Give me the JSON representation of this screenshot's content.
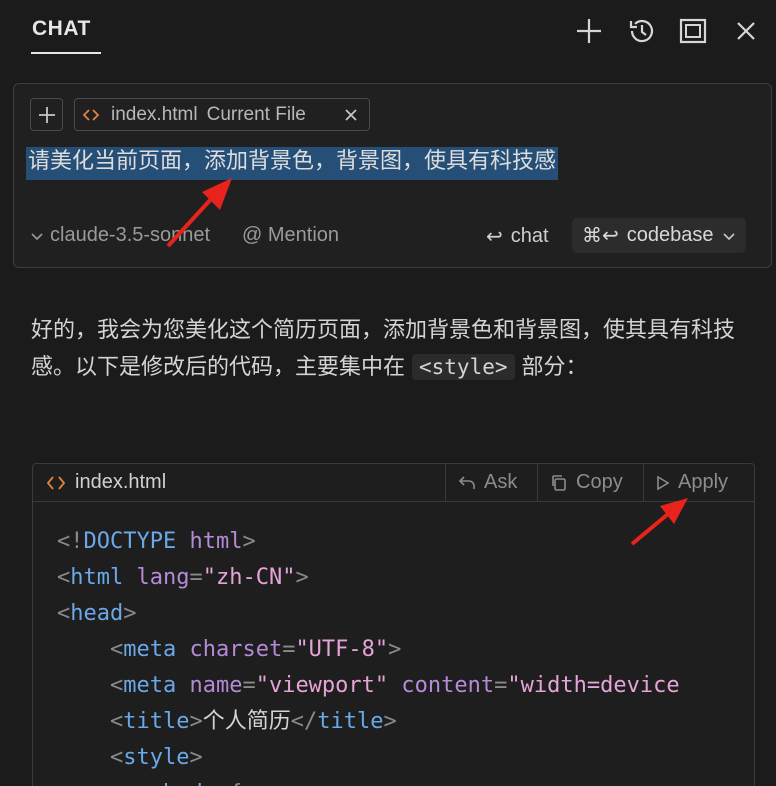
{
  "header": {
    "tab_label": "CHAT",
    "icons": [
      "plus-icon",
      "history-icon",
      "maximize-icon",
      "close-icon"
    ]
  },
  "input": {
    "add_context_icon": "plus-icon",
    "file_chip": {
      "name": "index.html",
      "tag": "Current File"
    },
    "prompt": "请美化当前页面，添加背景色，背景图，使具有科技感",
    "model": "claude-3.5-sonnet",
    "mention": "@ Mention",
    "chat_label": "chat",
    "codebase_label": "codebase",
    "codebase_shortcut": "⌘↩"
  },
  "response": {
    "text_before": "好的，我会为您美化这个简历页面，添加背景色和背景图，使其具有科技感。以下是修改后的代码，主要集中在 ",
    "inline_code": "<style>",
    "text_after": " 部分："
  },
  "code_block": {
    "filename": "index.html",
    "actions": {
      "ask": "Ask",
      "copy": "Copy",
      "apply": "Apply"
    }
  },
  "colors": {
    "background": "#1b1b1b",
    "selection": "#264f78",
    "tag": "#6aa8e8",
    "attr": "#b58ad8",
    "string": "#e6a3d8",
    "arrow": "#e8231c"
  }
}
